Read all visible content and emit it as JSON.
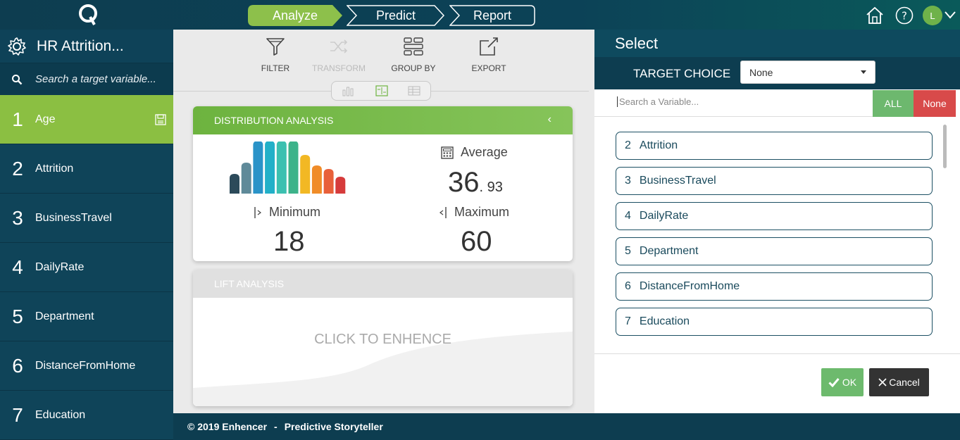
{
  "topbar": {
    "steps": [
      {
        "label": "Analyze",
        "active": true
      },
      {
        "label": "Predict",
        "active": false
      },
      {
        "label": "Report",
        "active": false
      }
    ],
    "user_initial": "L"
  },
  "sidebar": {
    "title": "HR Attrition...",
    "search_placeholder": "Search a target variable...",
    "items": [
      {
        "num": "1",
        "label": "Age",
        "active": true
      },
      {
        "num": "2",
        "label": "Attrition"
      },
      {
        "num": "3",
        "label": "BusinessTravel"
      },
      {
        "num": "4",
        "label": "DailyRate"
      },
      {
        "num": "5",
        "label": "Department"
      },
      {
        "num": "6",
        "label": "DistanceFromHome"
      },
      {
        "num": "7",
        "label": "Education"
      }
    ]
  },
  "toolbar": {
    "filter": "FILTER",
    "transform": "TRANSFORM",
    "group_by": "GROUP BY",
    "export": "EXPORT"
  },
  "distribution": {
    "title": "DISTRIBUTION ANALYSIS",
    "average_label": "Average",
    "average_int": "36",
    "average_dec": ". 93",
    "minimum_label": "Minimum",
    "minimum_value": "18",
    "maximum_label": "Maximum",
    "maximum_value": "60",
    "bar_colors": [
      "#2c4a5a",
      "#5f8a99",
      "#2a93c8",
      "#22b0c8",
      "#3cc0b0",
      "#3db38a",
      "#f2b824",
      "#f08c28",
      "#e8603a",
      "#d63b3b"
    ]
  },
  "lift": {
    "title": "LIFT ANALYSIS",
    "cta": "CLICK TO ENHENCE"
  },
  "footer": {
    "copyright": "© 2019 Enhencer",
    "separator": "-",
    "tagline": "Predictive Storyteller"
  },
  "select_panel": {
    "title": "Select",
    "target_choice_label": "TARGET CHOICE",
    "target_choice_value": "None",
    "search_placeholder": "Search a Variable...",
    "all_label": "ALL",
    "none_label": "None",
    "variables": [
      {
        "num": "2",
        "label": "Attrition"
      },
      {
        "num": "3",
        "label": "BusinessTravel"
      },
      {
        "num": "4",
        "label": "DailyRate"
      },
      {
        "num": "5",
        "label": "Department"
      },
      {
        "num": "6",
        "label": "DistanceFromHome"
      },
      {
        "num": "7",
        "label": "Education"
      }
    ],
    "ok_label": "OK",
    "cancel_label": "Cancel"
  }
}
